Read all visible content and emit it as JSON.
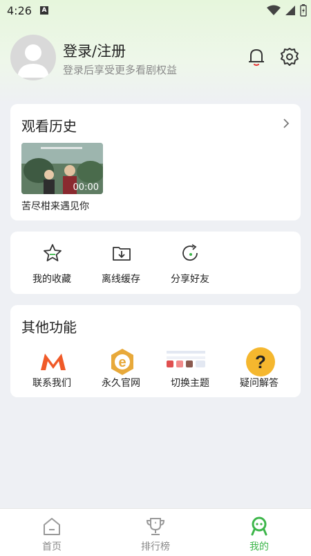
{
  "statusbar": {
    "time": "4:26",
    "notif_letter": "A"
  },
  "profile": {
    "name": "登录/注册",
    "subtitle": "登录后享受更多看剧权益"
  },
  "history": {
    "title": "观看历史",
    "item": {
      "title": "苦尽柑来遇见你",
      "duration": "00:00"
    }
  },
  "actions": [
    {
      "label": "我的收藏",
      "icon": "star-icon"
    },
    {
      "label": "离线缓存",
      "icon": "download-folder-icon"
    },
    {
      "label": "分享好友",
      "icon": "share-icon"
    }
  ],
  "other": {
    "title": "其他功能",
    "items": [
      {
        "label": "联系我们",
        "icon": "m-logo-icon"
      },
      {
        "label": "永久官网",
        "icon": "ie-logo-icon"
      },
      {
        "label": "切换主题",
        "icon": "theme-palette-icon"
      },
      {
        "label": "疑问解答",
        "icon": "question-icon"
      }
    ]
  },
  "tabs": [
    {
      "label": "首页",
      "icon": "home-icon"
    },
    {
      "label": "排行榜",
      "icon": "trophy-icon"
    },
    {
      "label": "我的",
      "icon": "profile-icon"
    }
  ],
  "colors": {
    "accent": "#3db64a",
    "bell_accent": "#e63c3c",
    "question_bg": "#f5b72e",
    "m_logo": "#f05a28",
    "ie_bg": "#e8a93a"
  }
}
